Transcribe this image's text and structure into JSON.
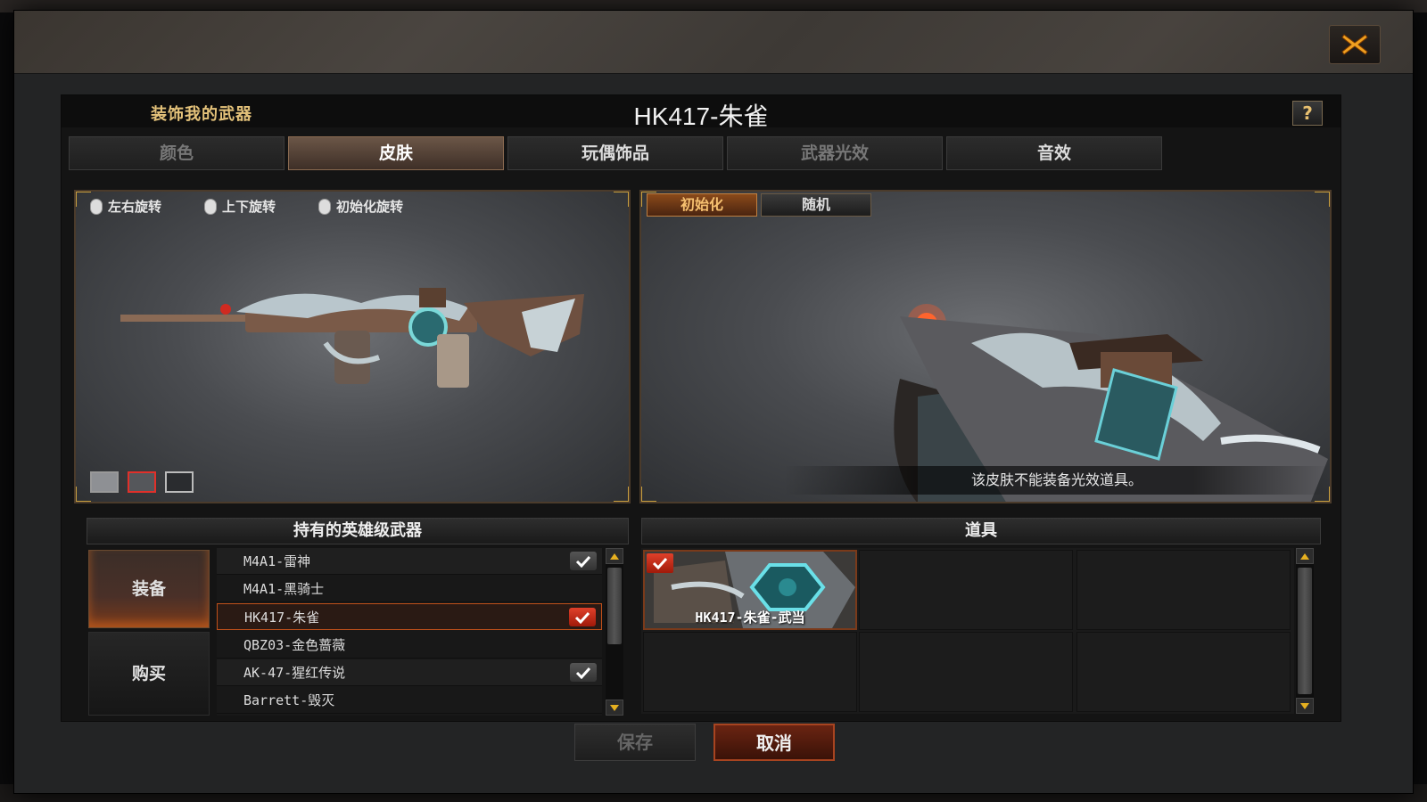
{
  "dialog": {
    "section_label": "装饰我的武器",
    "weapon_title": "HK417-朱雀",
    "help_label": "?"
  },
  "tabs": [
    {
      "label": "颜色",
      "active": false
    },
    {
      "label": "皮肤",
      "active": true
    },
    {
      "label": "玩偶饰品",
      "active": false
    },
    {
      "label": "武器光效",
      "active": false
    },
    {
      "label": "音效",
      "active": false
    }
  ],
  "left_preview": {
    "hints": [
      "左右旋转",
      "上下旋转",
      "初始化旋转"
    ],
    "swatches": [
      {
        "color": "#8e9094",
        "selected": false
      },
      {
        "color": "#55575b",
        "selected": true
      },
      {
        "color": "#2a2c2f",
        "selected": false
      }
    ]
  },
  "right_preview": {
    "reset_label": "初始化",
    "random_label": "随机",
    "notice": "该皮肤不能装备光效道具。"
  },
  "weapons_panel": {
    "title": "持有的英雄级武器",
    "equip_label": "装备",
    "buy_label": "购买",
    "rows": [
      {
        "name": "M4A1-雷神",
        "check": "grey"
      },
      {
        "name": "M4A1-黑骑士",
        "check": ""
      },
      {
        "name": "HK417-朱雀",
        "check": "red",
        "selected": true
      },
      {
        "name": "QBZ03-金色蔷薇",
        "check": ""
      },
      {
        "name": "AK-47-猩红传说",
        "check": "grey"
      },
      {
        "name": "Barrett-毁灭",
        "check": ""
      }
    ]
  },
  "items_panel": {
    "title": "道具",
    "items": [
      {
        "name": "HK417-朱雀-武当",
        "checked": true
      }
    ]
  },
  "footer": {
    "save_label": "保存",
    "cancel_label": "取消"
  },
  "colors": {
    "accent_gold": "#c9a040",
    "accent_orange": "#c0501a",
    "check_red": "#e0402a"
  }
}
